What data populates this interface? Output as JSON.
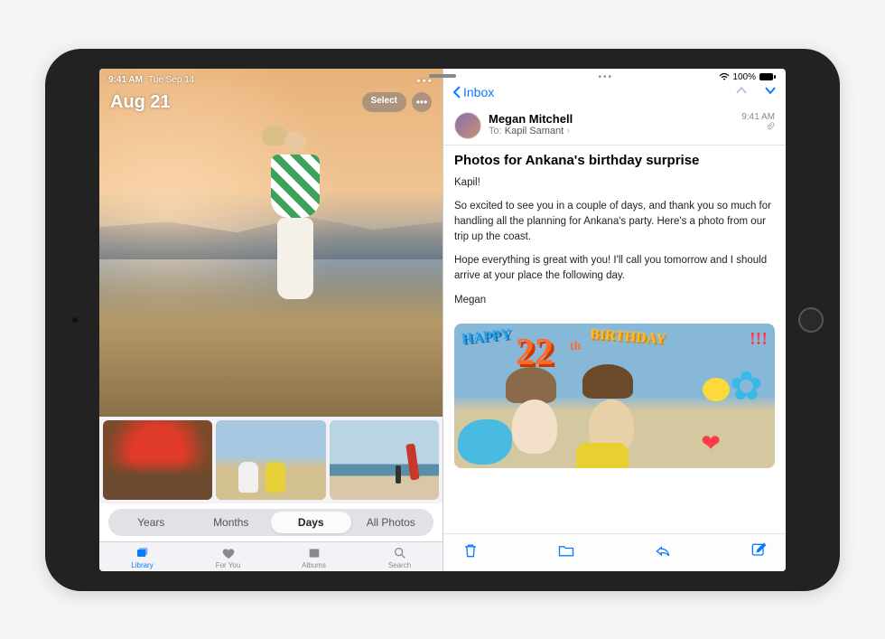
{
  "status": {
    "time": "9:41 AM",
    "date": "Tue Sep 14",
    "battery_pct": "100%"
  },
  "photos": {
    "heading_date": "Aug 21",
    "select_label": "Select",
    "segments": {
      "years": "Years",
      "months": "Months",
      "days": "Days",
      "all": "All Photos"
    },
    "active_segment": "days",
    "tabs": {
      "library": "Library",
      "foryou": "For You",
      "albums": "Albums",
      "search": "Search"
    },
    "active_tab": "library"
  },
  "mail": {
    "back_label": "Inbox",
    "from_name": "Megan Mitchell",
    "to_label": "To:",
    "to_name": "Kapil Samant",
    "received_time": "9:41 AM",
    "subject": "Photos for Ankana's birthday surprise",
    "body_p1": "Kapil!",
    "body_p2": "So excited to see you in a couple of days, and thank you so much for handling all the planning for Ankana's party. Here's a photo from our trip up the coast.",
    "body_p3": "Hope everything is great with you! I'll call you tomorrow and I should arrive at your place the following day.",
    "body_sign": "Megan",
    "doodle_happy": "HAPPY",
    "doodle_num": "22",
    "doodle_th": "th",
    "doodle_bday": "BIRTHDAY",
    "doodle_excl": "!!!"
  }
}
